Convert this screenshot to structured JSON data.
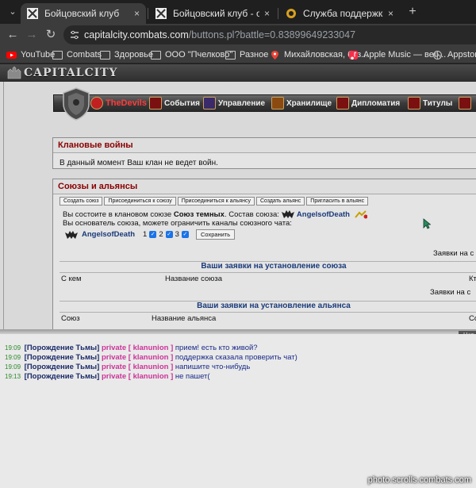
{
  "tabs": [
    {
      "title": "Бойцовский клуб",
      "close": "×"
    },
    {
      "title": "Бойцовский клуб - онлайн игр",
      "close": "×"
    },
    {
      "title": "Служба поддержки Бойцовско",
      "close": "×"
    }
  ],
  "new_tab": "+",
  "address": {
    "host": "capitalcity.combats.com",
    "path": "/buttons.pl?battle=0.83899649233047"
  },
  "bookmarks": [
    "YouTube",
    "Combats",
    "Здоровье",
    "ООО \"Пчелково\"",
    "Разное",
    "Михайловская, баз...",
    "Apple Music — веб...",
    "Appstorre"
  ],
  "logo_text": "CAPITALCITY",
  "menu": [
    "TheDevils",
    "События",
    "Управление",
    "Хранилище",
    "Дипломатия",
    "Титулы"
  ],
  "wars": {
    "title": "Клановые войны",
    "text": "В данный момент Ваш клан не ведет войн."
  },
  "alliances": {
    "title": "Союзы и альянсы",
    "buttons": [
      "Создать союз",
      "Присоединиться к союзу",
      "Присоединиться к альянсу",
      "Создать альянс",
      "Пригласить в альянс"
    ],
    "line1_pre": "Вы состоите в клановом союзе",
    "line1_union": "Союз темных",
    "line1_post": ". Состав союза:",
    "clan": "AngelsofDeath",
    "line2": "Вы основатель союза, можете ограничить каналы союзного чата:",
    "channels": [
      "1",
      "2",
      "3"
    ],
    "save": "Сохранить",
    "right1": "Заявки на с",
    "union_req_title": "Ваши заявки на установление союза",
    "col_with": "С кем",
    "col_union_name": "Название союза",
    "col_right1": "Кт",
    "right2": "Заявки на с",
    "alliance_req_title": "Ваши заявки на установление альянса",
    "col_union": "Союз",
    "col_alliance_name": "Название альянса",
    "col_right2": "Со"
  },
  "chat_tab": "Чат",
  "chat": [
    {
      "time": "19:09",
      "name": "[Порождение Тьмы]",
      "channel": "private [ klanunion ]",
      "msg": "прием! есть кто живой?"
    },
    {
      "time": "19:09",
      "name": "[Порождение Тьмы]",
      "channel": "private [ klanunion ]",
      "msg": "поддержка сказала проверить чат)"
    },
    {
      "time": "19:09",
      "name": "[Порождение Тьмы]",
      "channel": "private [ klanunion ]",
      "msg": "напишите что-нибудь"
    },
    {
      "time": "19:13",
      "name": "[Порождение Тьмы]",
      "channel": "private [ klanunion ]",
      "msg": "не пашет("
    }
  ],
  "watermark": "photo.scrolls.combats.com",
  "colors": {
    "clan_title_red": "#8b0000",
    "link_blue": "#1a3a7a",
    "chat_private": "#cc3399",
    "chat_time": "#2a8a2a"
  }
}
